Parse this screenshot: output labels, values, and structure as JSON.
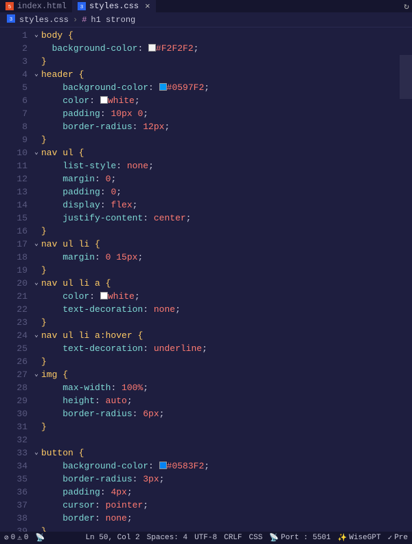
{
  "tabs": [
    {
      "label": "index.html",
      "icon_color": "#e44d26",
      "active": false
    },
    {
      "label": "styles.css",
      "icon_color": "#2965f1",
      "active": true
    }
  ],
  "breadcrumb": {
    "file_icon_color": "#2965f1",
    "file": "styles.css",
    "symbol_icon": "#",
    "symbol": "h1 strong"
  },
  "colors": {
    "f2": "#F2F2F2",
    "c0597": "#0597F2",
    "c0583": "#0583F2"
  },
  "code_tokens": [
    {
      "n": 1,
      "fold": true,
      "t": [
        [
          "body ",
          "sel"
        ],
        [
          "{",
          "brace"
        ]
      ]
    },
    {
      "n": 2,
      "t": [
        [
          "  ",
          null
        ],
        [
          "background-color",
          "prop"
        ],
        [
          ": ",
          "punc"
        ],
        [
          "SWATCH:f2",
          null
        ],
        [
          "#F2F2F2",
          "val"
        ],
        [
          ";",
          "punc"
        ]
      ]
    },
    {
      "n": 3,
      "t": [
        [
          "}",
          "brace"
        ]
      ]
    },
    {
      "n": 4,
      "fold": true,
      "t": [
        [
          "header ",
          "sel"
        ],
        [
          "{",
          "brace"
        ]
      ]
    },
    {
      "n": 5,
      "t": [
        [
          "    ",
          null
        ],
        [
          "background-color",
          "prop"
        ],
        [
          ": ",
          "punc"
        ],
        [
          "SWATCH:c0597",
          null
        ],
        [
          "#0597F2",
          "val"
        ],
        [
          ";",
          "punc"
        ]
      ]
    },
    {
      "n": 6,
      "t": [
        [
          "    ",
          null
        ],
        [
          "color",
          "prop"
        ],
        [
          ": ",
          "punc"
        ],
        [
          "SWATCH:white",
          null
        ],
        [
          "white",
          "val"
        ],
        [
          ";",
          "punc"
        ]
      ]
    },
    {
      "n": 7,
      "t": [
        [
          "    ",
          null
        ],
        [
          "padding",
          "prop"
        ],
        [
          ": ",
          "punc"
        ],
        [
          "10px 0",
          "val"
        ],
        [
          ";",
          "punc"
        ]
      ]
    },
    {
      "n": 8,
      "t": [
        [
          "    ",
          null
        ],
        [
          "border-radius",
          "prop"
        ],
        [
          ": ",
          "punc"
        ],
        [
          "12px",
          "val"
        ],
        [
          ";",
          "punc"
        ]
      ]
    },
    {
      "n": 9,
      "t": [
        [
          "}",
          "brace"
        ]
      ]
    },
    {
      "n": 10,
      "fold": true,
      "t": [
        [
          "nav ul ",
          "sel"
        ],
        [
          "{",
          "brace"
        ]
      ]
    },
    {
      "n": 11,
      "t": [
        [
          "    ",
          null
        ],
        [
          "list-style",
          "prop"
        ],
        [
          ": ",
          "punc"
        ],
        [
          "none",
          "val"
        ],
        [
          ";",
          "punc"
        ]
      ]
    },
    {
      "n": 12,
      "t": [
        [
          "    ",
          null
        ],
        [
          "margin",
          "prop"
        ],
        [
          ": ",
          "punc"
        ],
        [
          "0",
          "val"
        ],
        [
          ";",
          "punc"
        ]
      ]
    },
    {
      "n": 13,
      "t": [
        [
          "    ",
          null
        ],
        [
          "padding",
          "prop"
        ],
        [
          ": ",
          "punc"
        ],
        [
          "0",
          "val"
        ],
        [
          ";",
          "punc"
        ]
      ]
    },
    {
      "n": 14,
      "t": [
        [
          "    ",
          null
        ],
        [
          "display",
          "prop"
        ],
        [
          ": ",
          "punc"
        ],
        [
          "flex",
          "val"
        ],
        [
          ";",
          "punc"
        ]
      ]
    },
    {
      "n": 15,
      "t": [
        [
          "    ",
          null
        ],
        [
          "justify-content",
          "prop"
        ],
        [
          ": ",
          "punc"
        ],
        [
          "center",
          "val"
        ],
        [
          ";",
          "punc"
        ]
      ]
    },
    {
      "n": 16,
      "t": [
        [
          "}",
          "brace"
        ]
      ]
    },
    {
      "n": 17,
      "fold": true,
      "t": [
        [
          "nav ul li ",
          "sel"
        ],
        [
          "{",
          "brace"
        ]
      ]
    },
    {
      "n": 18,
      "t": [
        [
          "    ",
          null
        ],
        [
          "margin",
          "prop"
        ],
        [
          ": ",
          "punc"
        ],
        [
          "0 15px",
          "val"
        ],
        [
          ";",
          "punc"
        ]
      ]
    },
    {
      "n": 19,
      "t": [
        [
          "}",
          "brace"
        ]
      ]
    },
    {
      "n": 20,
      "fold": true,
      "t": [
        [
          "nav ul li a ",
          "sel"
        ],
        [
          "{",
          "brace"
        ]
      ]
    },
    {
      "n": 21,
      "t": [
        [
          "    ",
          null
        ],
        [
          "color",
          "prop"
        ],
        [
          ": ",
          "punc"
        ],
        [
          "SWATCH:white",
          null
        ],
        [
          "white",
          "val"
        ],
        [
          ";",
          "punc"
        ]
      ]
    },
    {
      "n": 22,
      "t": [
        [
          "    ",
          null
        ],
        [
          "text-decoration",
          "prop"
        ],
        [
          ": ",
          "punc"
        ],
        [
          "none",
          "val"
        ],
        [
          ";",
          "punc"
        ]
      ]
    },
    {
      "n": 23,
      "t": [
        [
          "}",
          "brace"
        ]
      ]
    },
    {
      "n": 24,
      "fold": true,
      "t": [
        [
          "nav ul li a:hover ",
          "sel"
        ],
        [
          "{",
          "brace"
        ]
      ]
    },
    {
      "n": 25,
      "t": [
        [
          "    ",
          null
        ],
        [
          "text-decoration",
          "prop"
        ],
        [
          ": ",
          "punc"
        ],
        [
          "underline",
          "val"
        ],
        [
          ";",
          "punc"
        ]
      ]
    },
    {
      "n": 26,
      "t": [
        [
          "}",
          "brace"
        ]
      ]
    },
    {
      "n": 27,
      "fold": true,
      "t": [
        [
          "img ",
          "sel"
        ],
        [
          "{",
          "brace"
        ]
      ]
    },
    {
      "n": 28,
      "t": [
        [
          "    ",
          null
        ],
        [
          "max-width",
          "prop"
        ],
        [
          ": ",
          "punc"
        ],
        [
          "100%",
          "val"
        ],
        [
          ";",
          "punc"
        ]
      ]
    },
    {
      "n": 29,
      "t": [
        [
          "    ",
          null
        ],
        [
          "height",
          "prop"
        ],
        [
          ": ",
          "punc"
        ],
        [
          "auto",
          "val"
        ],
        [
          ";",
          "punc"
        ]
      ]
    },
    {
      "n": 30,
      "t": [
        [
          "    ",
          null
        ],
        [
          "border-radius",
          "prop"
        ],
        [
          ": ",
          "punc"
        ],
        [
          "6px",
          "val"
        ],
        [
          ";",
          "punc"
        ]
      ]
    },
    {
      "n": 31,
      "t": [
        [
          "}",
          "brace"
        ]
      ]
    },
    {
      "n": 32,
      "t": [
        [
          "",
          null
        ]
      ]
    },
    {
      "n": 33,
      "fold": true,
      "t": [
        [
          "button ",
          "sel"
        ],
        [
          "{",
          "brace"
        ]
      ]
    },
    {
      "n": 34,
      "t": [
        [
          "    ",
          null
        ],
        [
          "background-color",
          "prop"
        ],
        [
          ": ",
          "punc"
        ],
        [
          "SWATCH:c0583",
          null
        ],
        [
          "#0583F2",
          "val"
        ],
        [
          ";",
          "punc"
        ]
      ]
    },
    {
      "n": 35,
      "t": [
        [
          "    ",
          null
        ],
        [
          "border-radius",
          "prop"
        ],
        [
          ": ",
          "punc"
        ],
        [
          "3px",
          "val"
        ],
        [
          ";",
          "punc"
        ]
      ]
    },
    {
      "n": 36,
      "t": [
        [
          "    ",
          null
        ],
        [
          "padding",
          "prop"
        ],
        [
          ": ",
          "punc"
        ],
        [
          "4px",
          "val"
        ],
        [
          ";",
          "punc"
        ]
      ]
    },
    {
      "n": 37,
      "t": [
        [
          "    ",
          null
        ],
        [
          "cursor",
          "prop"
        ],
        [
          ": ",
          "punc"
        ],
        [
          "pointer",
          "val"
        ],
        [
          ";",
          "punc"
        ]
      ]
    },
    {
      "n": 38,
      "t": [
        [
          "    ",
          null
        ],
        [
          "border",
          "prop"
        ],
        [
          ": ",
          "punc"
        ],
        [
          "none",
          "val"
        ],
        [
          ";",
          "punc"
        ]
      ]
    },
    {
      "n": 39,
      "t": [
        [
          "}",
          "brace"
        ]
      ]
    }
  ],
  "statusbar": {
    "errors": "0",
    "warnings": "0",
    "position": "Ln 50, Col 2",
    "spaces": "Spaces: 4",
    "encoding": "UTF-8",
    "eol": "CRLF",
    "lang": "CSS",
    "port": "Port : 5501",
    "wisegpt": "WiseGPT",
    "pre": "Pre"
  }
}
